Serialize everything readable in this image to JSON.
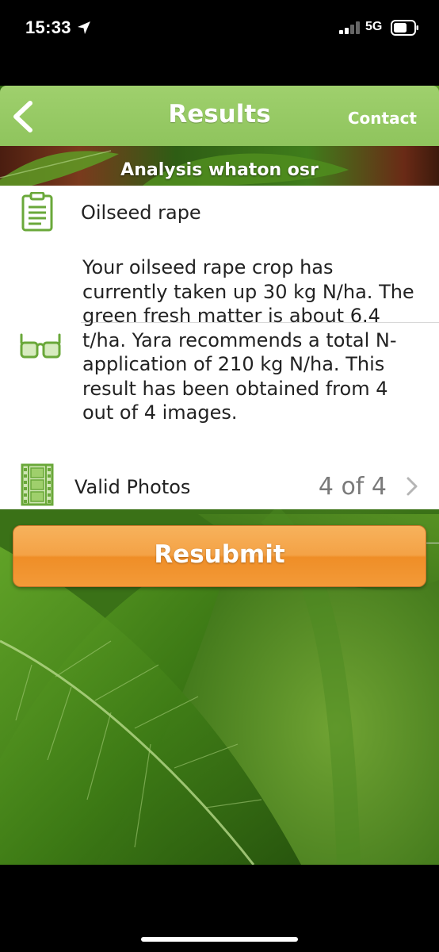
{
  "status_bar": {
    "time": "15:33",
    "network": "5G",
    "icons": [
      "location-arrow-icon",
      "signal-icon",
      "battery-icon"
    ]
  },
  "nav": {
    "back_icon": "chevron-left-icon",
    "title": "Results",
    "contact_label": "Contact"
  },
  "analysis": {
    "title": "Analysis whaton osr"
  },
  "crop": {
    "icon": "clipboard-icon",
    "name": "Oilseed rape"
  },
  "result": {
    "icon": "glasses-icon",
    "text": "Your oilseed rape crop has currently taken up 30 kg N/ha. The green fresh matter is about 6.4 t/ha. Yara recommends a total N-application of 210 kg N/ha. This result has been obtained from 4 out of 4 images."
  },
  "photos": {
    "icon": "film-strip-icon",
    "label": "Valid Photos",
    "count": "4 of 4",
    "chevron_icon": "chevron-right-icon"
  },
  "resubmit": {
    "label": "Resubmit"
  },
  "colors": {
    "nav_green": "#9fd06d",
    "icon_green": "#6aa83a",
    "button_orange": "#f4a246",
    "text_dark": "#222222",
    "count_gray": "#7a7a7a"
  }
}
